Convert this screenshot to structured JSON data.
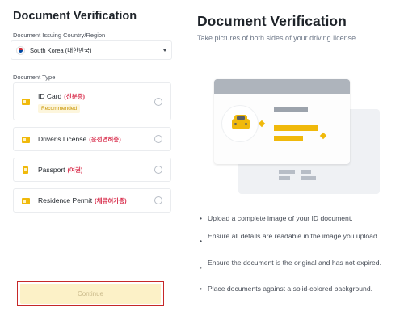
{
  "left": {
    "title": "Document Verification",
    "country_label": "Document Issuing Country/Region",
    "country_value": "South Korea (대한민국)",
    "doc_type_label": "Document Type",
    "options": [
      {
        "label": "ID Card",
        "ko": "(신분증)",
        "badge": "Recommended",
        "icon": "id-card-icon"
      },
      {
        "label": "Driver's License",
        "ko": "(운전면허증)",
        "icon": "license-icon"
      },
      {
        "label": "Passport",
        "ko": "(여권)",
        "icon": "passport-icon"
      },
      {
        "label": "Residence Permit",
        "ko": "(체류허가증)",
        "icon": "permit-icon"
      }
    ],
    "continue_label": "Continue"
  },
  "right": {
    "title": "Document Verification",
    "subtitle": "Take pictures of both sides of your driving license",
    "bullets": [
      "Upload a complete image of your ID document.",
      "Ensure all details are readable in the image you upload.",
      "Ensure the document is the original and has not expired.",
      "Place documents against a solid-colored background."
    ]
  },
  "colors": {
    "accent": "#f0b90b",
    "korean_text": "#d9304e",
    "highlight_outline": "#c62828"
  }
}
